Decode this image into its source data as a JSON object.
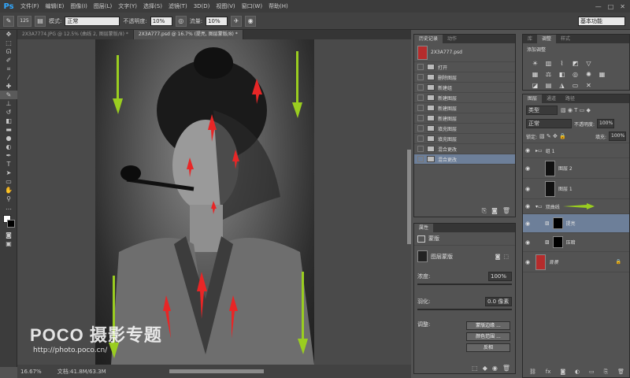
{
  "menubar": {
    "logo": "Ps",
    "items": [
      "文件(F)",
      "编辑(E)",
      "图像(I)",
      "图层(L)",
      "文字(Y)",
      "选择(S)",
      "滤镜(T)",
      "3D(D)",
      "视图(V)",
      "窗口(W)",
      "帮助(H)"
    ]
  },
  "options": {
    "brush_size": "125",
    "mode_label": "模式:",
    "mode_value": "正常",
    "opacity_label": "不透明度:",
    "opacity_value": "10%",
    "flow_label": "流量:",
    "flow_value": "10%",
    "workspace": "基本功能"
  },
  "tabs": [
    {
      "label": "2X3A7774.JPG @ 12.5% (曲线 2, 图层蒙版/8) *"
    },
    {
      "label": "2X3A777.psd @ 16.7% (提亮, 图层蒙版/8) *"
    }
  ],
  "status": {
    "zoom": "16.67%",
    "doc": "文档:41.8M/63.3M"
  },
  "watermark": {
    "brand": "POCO 摄影专题",
    "url": "http://photo.poco.cn/"
  },
  "history": {
    "tabs": [
      "历史记录",
      "动作"
    ],
    "snapshot": "2X3A777.psd",
    "items": [
      "打开",
      "删除图层",
      "新建组",
      "新建图层",
      "新建图层",
      "新建图层",
      "填充图层",
      "填充图层",
      "混合更改",
      "混合更改"
    ]
  },
  "properties": {
    "tab": "属性",
    "mask_label": "蒙版",
    "layer_mask": "图层蒙版",
    "density_label": "浓度:",
    "density_value": "100%",
    "feather_label": "羽化:",
    "feather_value": "0.0 像素",
    "adjust_label": "调整:",
    "btn_edge": "蒙版边缘 ...",
    "btn_color": "颜色范围 ...",
    "btn_invert": "反相"
  },
  "adjustments": {
    "tabs": [
      "库",
      "调整",
      "样式"
    ],
    "title": "添加调整",
    "icons": [
      "brightness-icon",
      "levels-icon",
      "curves-icon",
      "exposure-icon",
      "vibrance-icon",
      "hue-icon",
      "balance-icon",
      "bw-icon",
      "photo-filter-icon",
      "mixer-icon",
      "lookup-icon",
      "invert-icon",
      "posterize-icon",
      "threshold-icon",
      "gradient-map-icon",
      "selective-color-icon"
    ]
  },
  "layers": {
    "tabs": [
      "图层",
      "通道",
      "路径"
    ],
    "kind": "类型",
    "blend": "正常",
    "opacity_label": "不透明度:",
    "opacity_value": "100%",
    "lock_label": "锁定:",
    "fill_label": "填充:",
    "fill_value": "100%",
    "items": [
      {
        "name": "组 1",
        "type": "group"
      },
      {
        "name": "图层 2",
        "type": "layer"
      },
      {
        "name": "图层 1",
        "type": "layer"
      },
      {
        "name": "双曲线",
        "type": "group"
      },
      {
        "name": "提亮",
        "type": "adjust",
        "selected": true
      },
      {
        "name": "压暗",
        "type": "adjust"
      },
      {
        "name": "背景",
        "type": "bg"
      }
    ]
  }
}
